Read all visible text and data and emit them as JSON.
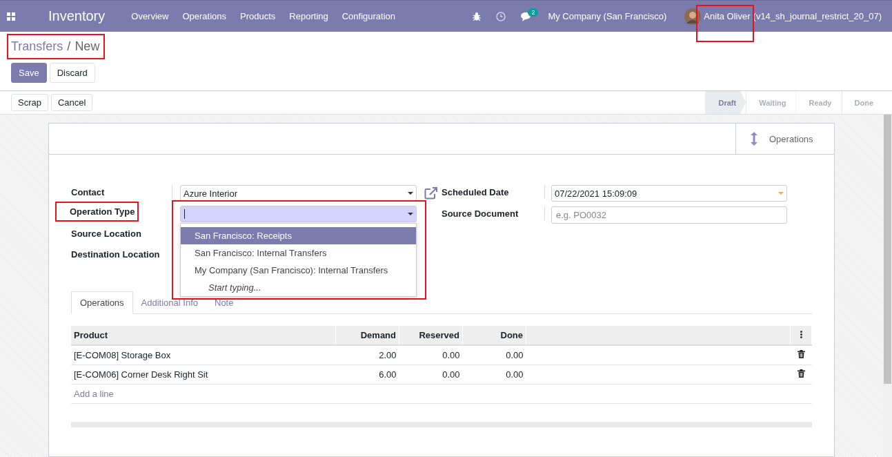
{
  "navbar": {
    "app": "Inventory",
    "menu": [
      "Overview",
      "Operations",
      "Products",
      "Reporting",
      "Configuration"
    ],
    "message_count": "2",
    "company": "My Company (San Francisco)",
    "user": "Anita Oliver",
    "database": "(v14_sh_journal_restrict_20_07)"
  },
  "breadcrumb": {
    "parent": "Transfers",
    "separator": "/",
    "current": "New"
  },
  "buttons": [
    {
      "label": "Save",
      "kind": "primary"
    },
    {
      "label": "Discard",
      "kind": "secondary"
    }
  ],
  "actions": [
    "Scrap",
    "Cancel"
  ],
  "status_steps": [
    {
      "label": "Draft",
      "selected": true
    },
    {
      "label": "Waiting",
      "selected": false
    },
    {
      "label": "Ready",
      "selected": false
    },
    {
      "label": "Done",
      "selected": false
    }
  ],
  "smart_button": "Operations",
  "left_fields": [
    {
      "label": "Contact",
      "kind": "select",
      "value": "Azure Interior"
    },
    {
      "label": "Operation Type",
      "kind": "select",
      "focused": true,
      "highlighted": true
    },
    {
      "label": "Source Location",
      "kind": "hidden"
    },
    {
      "label": "Destination Location",
      "kind": "hidden"
    }
  ],
  "dropdown": {
    "options": [
      {
        "label": "San Francisco: Receipts",
        "selected": true
      },
      {
        "label": "San Francisco: Internal Transfers",
        "selected": false
      },
      {
        "label": "My Company (San Francisco): Internal Transfers",
        "selected": false
      }
    ],
    "hint": "Start typing..."
  },
  "right_fields": [
    {
      "label": "Scheduled Date",
      "kind": "date",
      "value": "07/22/2021 15:09:09"
    },
    {
      "label": "Source Document",
      "kind": "text",
      "placeholder": "e.g. PO0032"
    }
  ],
  "tabs": [
    {
      "label": "Operations",
      "selected": true
    },
    {
      "label": "Additional Info",
      "selected": false
    },
    {
      "label": "Note",
      "selected": false
    }
  ],
  "table": {
    "columns": [
      "Product",
      "Demand",
      "Reserved",
      "Done"
    ],
    "rows": [
      [
        "[E-COM08] Storage Box",
        "2.00",
        "0.00",
        "0.00"
      ],
      [
        "[E-COM06] Corner Desk Right Sit",
        "6.00",
        "0.00",
        "0.00"
      ]
    ],
    "add_line": "Add a line"
  }
}
